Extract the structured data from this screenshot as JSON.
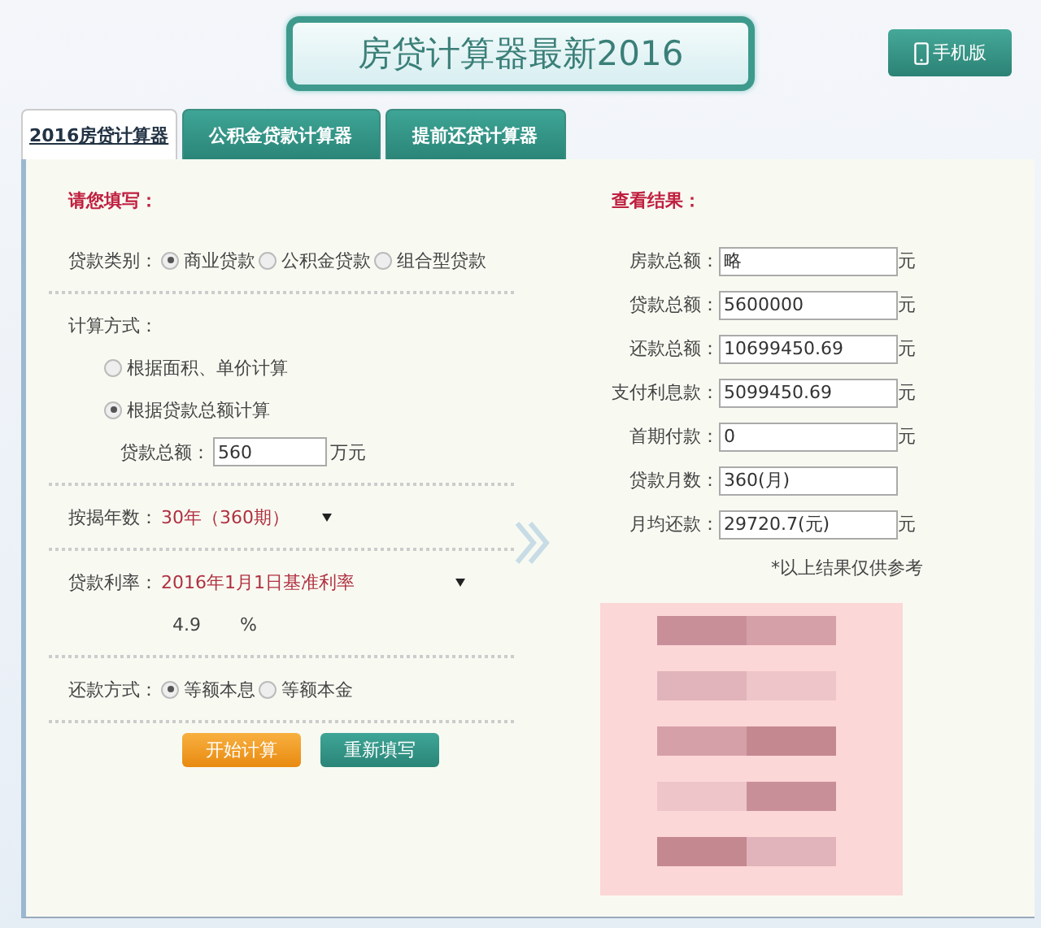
{
  "header": {
    "title": "房贷计算器最新2016",
    "mobile_button": "手机版"
  },
  "tabs": [
    {
      "label": "2016房贷计算器",
      "selected": true
    },
    {
      "label": "公积金贷款计算器",
      "selected": false
    },
    {
      "label": "提前还贷计算器",
      "selected": false
    }
  ],
  "form": {
    "heading": "请您填写：",
    "loan_type": {
      "label": "贷款类别：",
      "options": [
        {
          "label": "商业贷款",
          "selected": true
        },
        {
          "label": "公积金贷款",
          "selected": false
        },
        {
          "label": "组合型贷款",
          "selected": false
        }
      ]
    },
    "method": {
      "label": "计算方式：",
      "options": [
        {
          "label": "根据面积、单价计算",
          "selected": false
        },
        {
          "label": "根据贷款总额计算",
          "selected": true
        }
      ]
    },
    "loan_amount": {
      "label": "贷款总额：",
      "value": "560",
      "unit": "万元"
    },
    "years": {
      "label": "按揭年数：",
      "value": "30年（360期）"
    },
    "rate": {
      "label": "贷款利率：",
      "value": "2016年1月1日基准利率",
      "rate_value": "4.9",
      "unit": "%"
    },
    "repayment": {
      "label": "还款方式：",
      "options": [
        {
          "label": "等额本息",
          "selected": true
        },
        {
          "label": "等额本金",
          "selected": false
        }
      ]
    },
    "buttons": [
      {
        "label": "开始计算",
        "kind": "primary"
      },
      {
        "label": "重新填写",
        "kind": "secondary"
      }
    ]
  },
  "results": {
    "heading": "查看结果：",
    "rows": [
      {
        "label": "房款总额：",
        "value": "略",
        "unit": "元"
      },
      {
        "label": "贷款总额：",
        "value": "5600000",
        "unit": "元"
      },
      {
        "label": "还款总额：",
        "value": "10699450.69",
        "unit": "元"
      },
      {
        "label": "支付利息款：",
        "value": "5099450.69",
        "unit": "元"
      },
      {
        "label": "首期付款：",
        "value": "0",
        "unit": "元"
      },
      {
        "label": "贷款月数：",
        "value": "360(月)"
      },
      {
        "label": "月均还款：",
        "value": "29720.7(元)",
        "unit": "元"
      }
    ],
    "note": "*以上结果仅供参考"
  }
}
